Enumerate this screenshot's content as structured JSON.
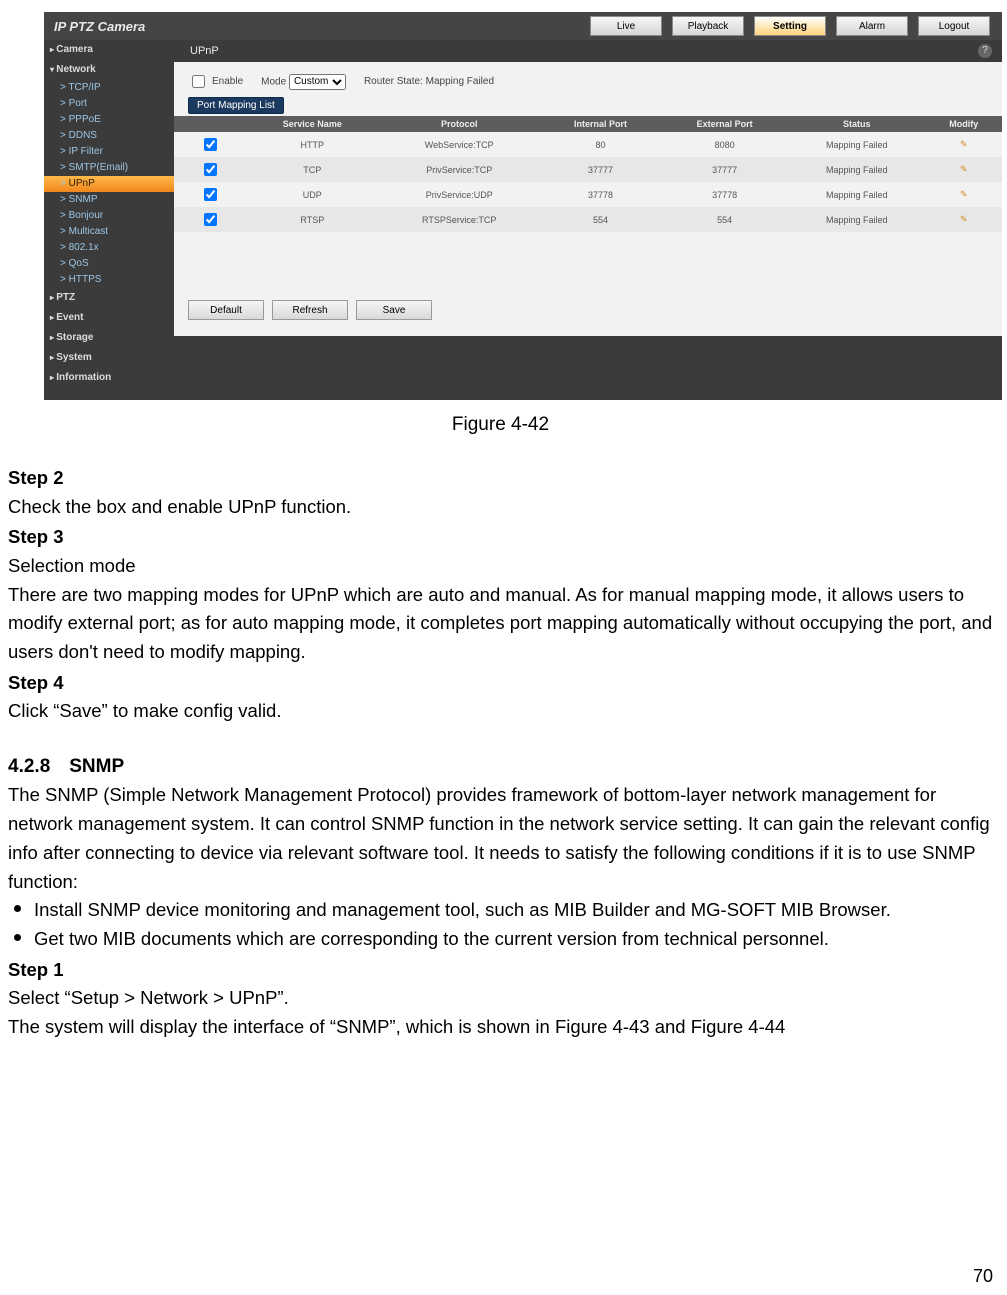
{
  "shot": {
    "logo": "IP PTZ Camera",
    "tabs": [
      "Live",
      "Playback",
      "Setting",
      "Alarm",
      "Logout"
    ],
    "activeTab": "Setting",
    "sidebar": {
      "cats": [
        "Camera",
        "Network",
        "PTZ",
        "Event",
        "Storage",
        "System",
        "Information"
      ],
      "network_items": [
        "TCP/IP",
        "Port",
        "PPPoE",
        "DDNS",
        "IP Filter",
        "SMTP(Email)",
        "UPnP",
        "SNMP",
        "Bonjour",
        "Multicast",
        "802.1x",
        "QoS",
        "HTTPS"
      ],
      "selected": "UPnP"
    },
    "page": {
      "title": "UPnP",
      "enable_label": "Enable",
      "mode_label": "Mode",
      "mode_value": "Custom",
      "router_label": "Router State:",
      "router_value": "Mapping Failed",
      "portlist_label": "Port Mapping List",
      "headers": [
        "",
        "Service Name",
        "Protocol",
        "Internal Port",
        "External Port",
        "Status",
        "Modify"
      ],
      "rows": [
        {
          "service": "HTTP",
          "protocol": "WebService:TCP",
          "int": "80",
          "ext": "8080",
          "status": "Mapping Failed"
        },
        {
          "service": "TCP",
          "protocol": "PrivService:TCP",
          "int": "37777",
          "ext": "37777",
          "status": "Mapping Failed"
        },
        {
          "service": "UDP",
          "protocol": "PrivService:UDP",
          "int": "37778",
          "ext": "37778",
          "status": "Mapping Failed"
        },
        {
          "service": "RTSP",
          "protocol": "RTSPService:TCP",
          "int": "554",
          "ext": "554",
          "status": "Mapping Failed"
        }
      ],
      "buttons": [
        "Default",
        "Refresh",
        "Save"
      ]
    }
  },
  "doc": {
    "fig": "Figure 4-42",
    "step2_h": "Step 2",
    "step2_t": "Check the box and enable UPnP function.",
    "step3_h": "Step 3",
    "step3_t1": "Selection mode",
    "step3_t2": "There are two mapping modes for UPnP which are auto and manual. As for manual mapping mode, it allows users to modify external port; as for auto mapping mode, it completes port mapping automatically without occupying the port, and users don't need to modify mapping.",
    "step4_h": "Step 4",
    "step4_t": "Click “Save” to make config valid.",
    "sec_h": "4.2.8 SNMP",
    "sec_p": "The SNMP (Simple Network Management Protocol) provides framework of bottom-layer network management for network management system. It can control SNMP function in the network service setting. It can gain the relevant config info after connecting to device via relevant software tool. It needs to satisfy the following conditions if it is to use SNMP function:",
    "b1": "Install SNMP device monitoring and management tool, such as MIB Builder and MG-SOFT MIB Browser.",
    "b2": "Get two MIB documents which are corresponding to the current version from technical personnel.",
    "step1_h": "Step 1",
    "step1_t1": "Select “Setup > Network > UPnP”.",
    "step1_t2": "The system will display the interface of “SNMP”, which is shown in Figure 4-43 and Figure 4-44",
    "pagenum": "70"
  }
}
